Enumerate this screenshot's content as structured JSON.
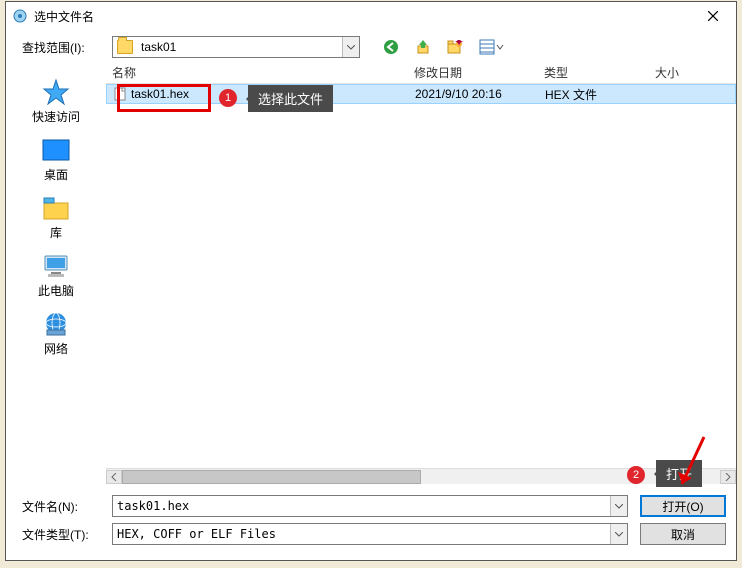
{
  "title": "选中文件名",
  "look_in_label": "查找范围(I):",
  "look_in_value": "task01",
  "columns": {
    "name": "名称",
    "date": "修改日期",
    "type": "类型",
    "size": "大小"
  },
  "rows": [
    {
      "name": "task01.hex",
      "date": "2021/9/10 20:16",
      "type": "HEX 文件",
      "size": ""
    }
  ],
  "places": {
    "quick": "快速访问",
    "desktop": "桌面",
    "library": "库",
    "thispc": "此电脑",
    "network": "网络"
  },
  "filename_label": "文件名(N):",
  "filename_value": "task01.hex",
  "filetype_label": "文件类型(T):",
  "filetype_value": "HEX, COFF or ELF Files",
  "open_btn": "打开(O)",
  "cancel_btn": "取消",
  "annotations": {
    "badge1": "1",
    "callout1": "选择此文件",
    "badge2": "2",
    "callout2": "打开"
  }
}
